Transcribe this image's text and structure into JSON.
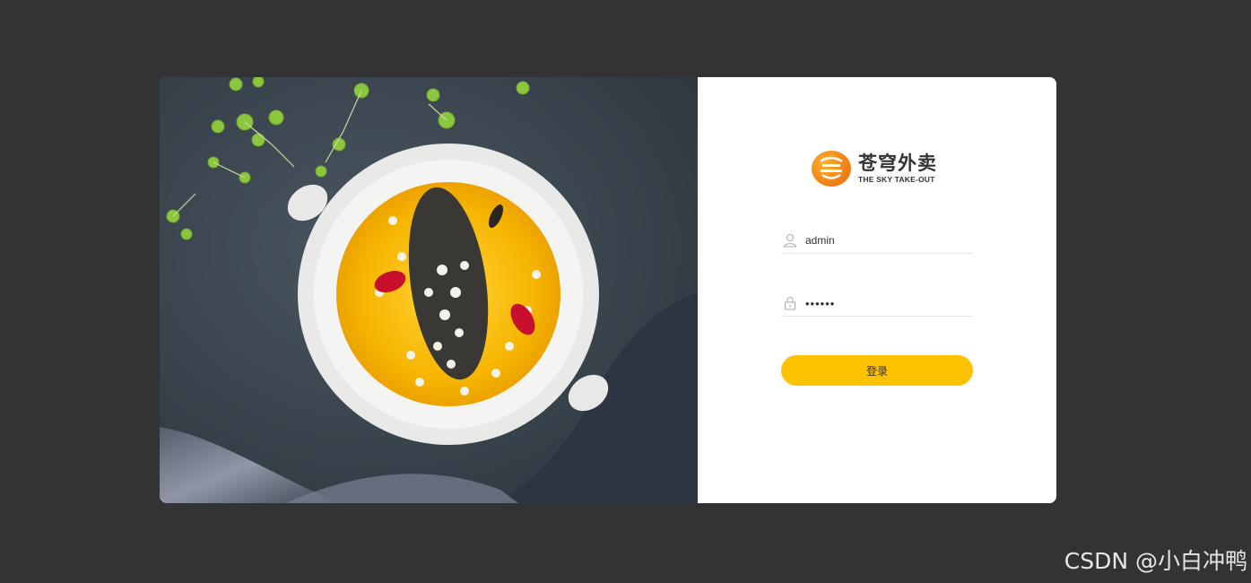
{
  "brand": {
    "name_cn": "苍穹外卖",
    "name_en": "THE SKY TAKE-OUT"
  },
  "form": {
    "username": {
      "value": "admin",
      "icon": "user-icon"
    },
    "password": {
      "value": "••••••",
      "icon": "lock-icon"
    },
    "submit_label": "登录"
  },
  "hero": {
    "image": "food-dish-photo"
  },
  "watermark": "CSDN @小白冲鸭",
  "colors": {
    "background": "#333333",
    "card": "#ffffff",
    "accent": "#ffc200",
    "logo_orange": "#f07a10"
  }
}
